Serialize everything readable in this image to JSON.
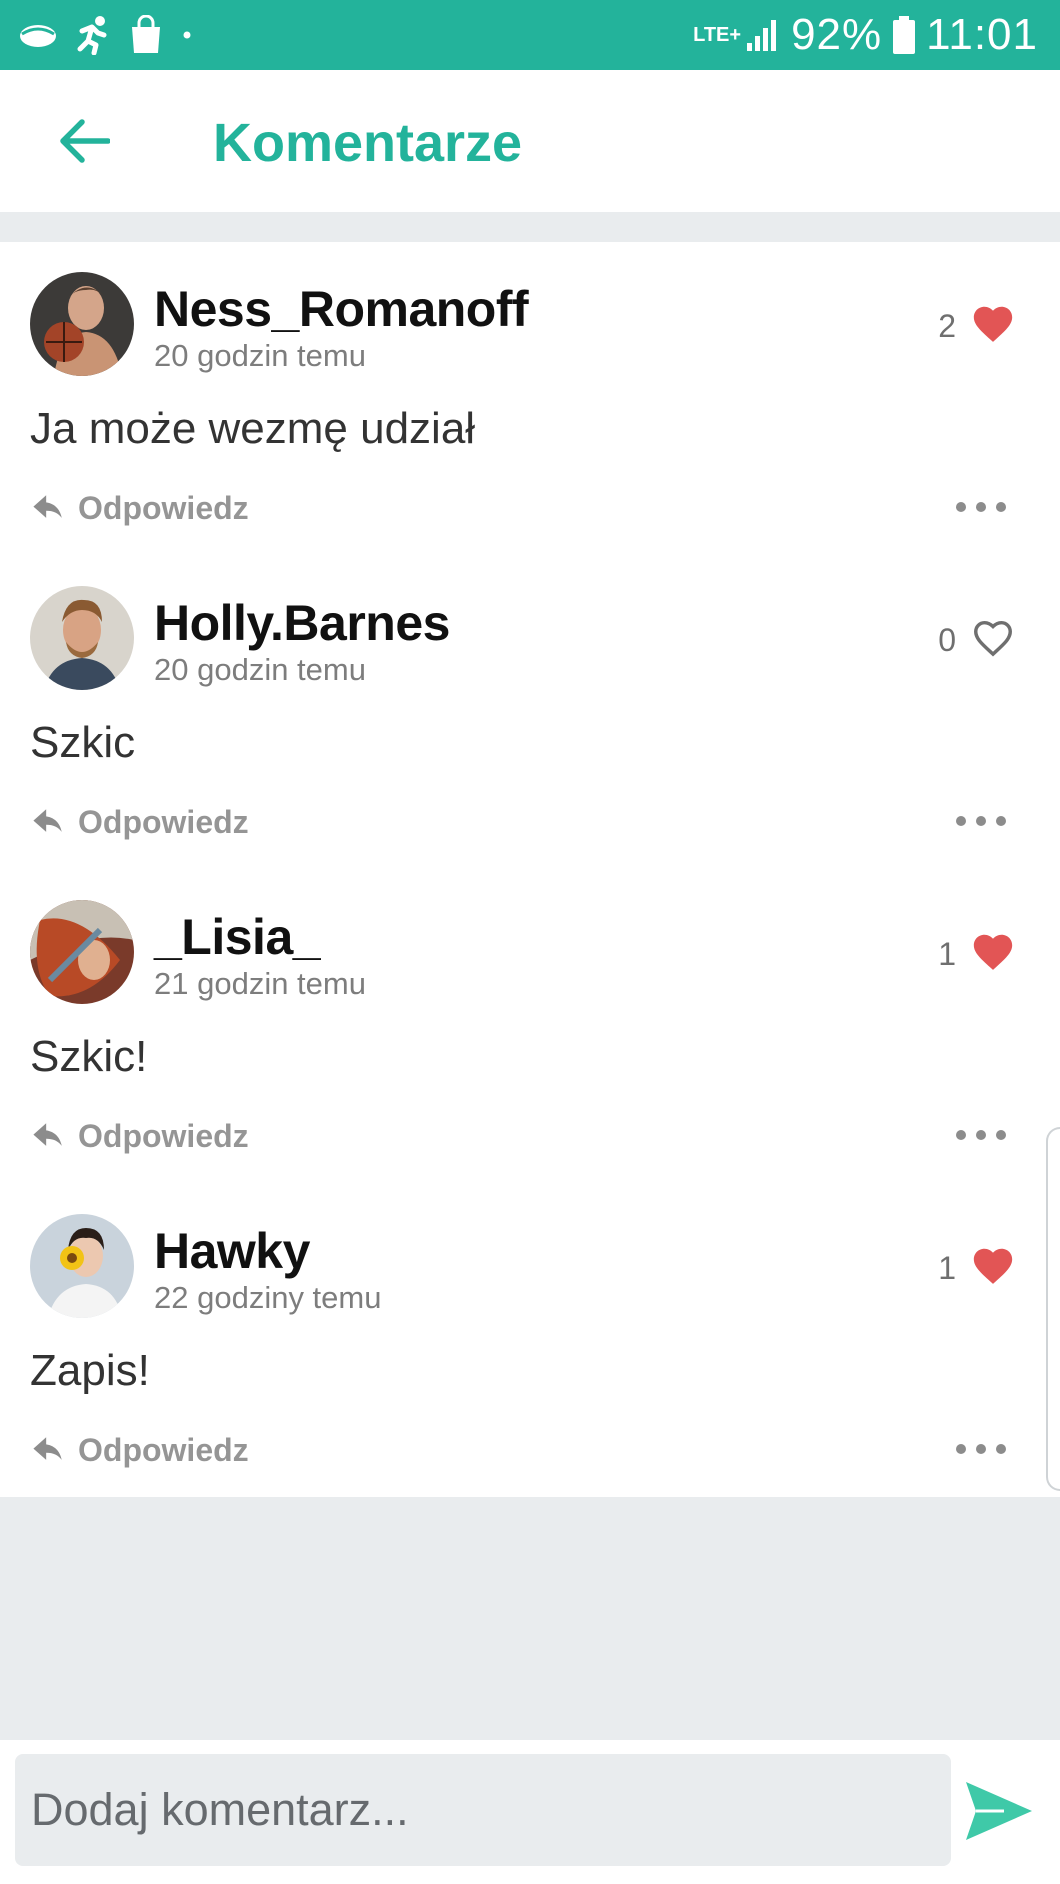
{
  "status_bar": {
    "network": "LTE+",
    "battery": "92%",
    "time": "11:01"
  },
  "header": {
    "title": "Komentarze"
  },
  "comments": [
    {
      "username": "Ness_Romanoff",
      "time": "20 godzin temu",
      "likes": "2",
      "liked": true,
      "text": "Ja może wezmę udział",
      "reply_label": "Odpowiedz"
    },
    {
      "username": "Holly.Barnes",
      "time": "20 godzin temu",
      "likes": "0",
      "liked": false,
      "text": "Szkic",
      "reply_label": "Odpowiedz"
    },
    {
      "username": "_Lisia_",
      "time": "21 godzin temu",
      "likes": "1",
      "liked": true,
      "text": "Szkic!",
      "reply_label": "Odpowiedz"
    },
    {
      "username": "Hawky",
      "time": "22 godziny temu",
      "likes": "1",
      "liked": true,
      "text": "Zapis!",
      "reply_label": "Odpowiedz"
    }
  ],
  "composer": {
    "placeholder": "Dodaj komentarz..."
  },
  "colors": {
    "accent": "#23b39b",
    "like_red": "#e25555",
    "background_gray": "#e9ecee"
  }
}
